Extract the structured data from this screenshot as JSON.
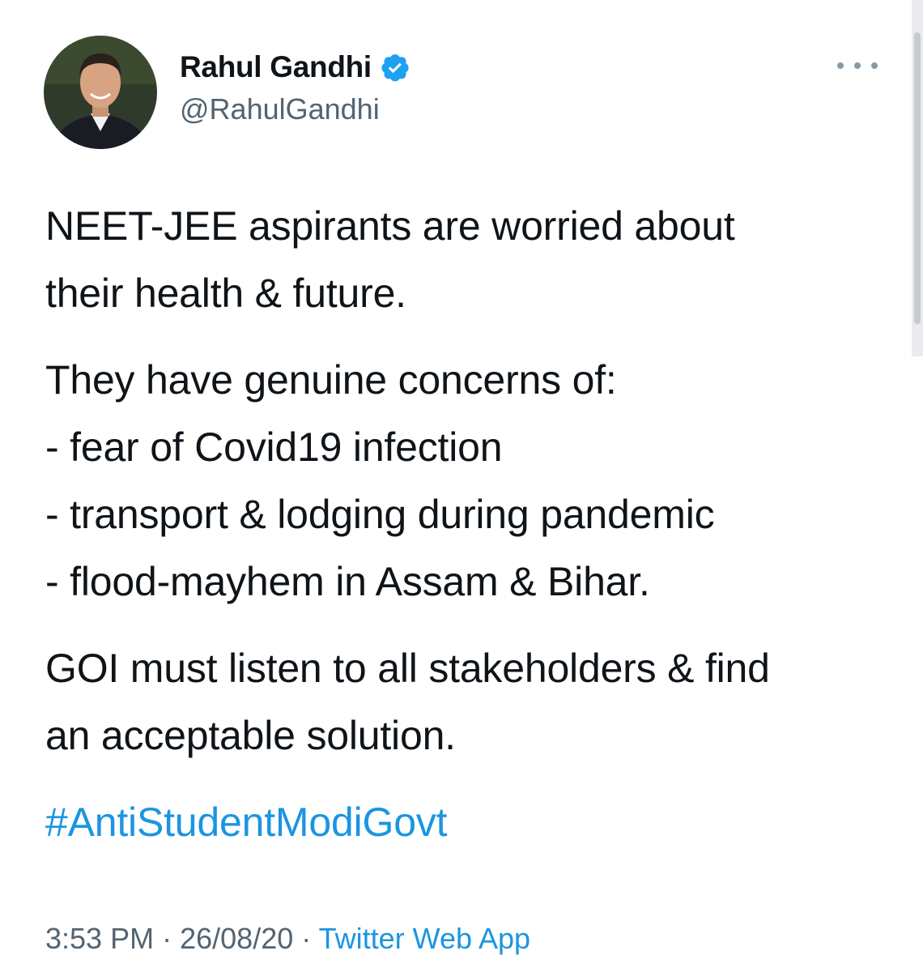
{
  "author": {
    "display_name": "Rahul Gandhi",
    "handle": "@RahulGandhi",
    "verified": true
  },
  "tweet": {
    "para1": [
      "NEET-JEE aspirants are worried about",
      "their health & future."
    ],
    "para2": [
      "They have genuine concerns of:",
      "- fear of Covid19 infection",
      "- transport & lodging during pandemic",
      "- flood-mayhem in Assam & Bihar."
    ],
    "para3": [
      "GOI must listen to all stakeholders & find",
      "an acceptable solution."
    ],
    "hashtag": "#AntiStudentModiGovt"
  },
  "meta": {
    "time": "3:53 PM",
    "separator": "·",
    "date": "26/08/20",
    "source": "Twitter Web App"
  },
  "colors": {
    "link": "#1b95e0",
    "secondary_text": "#536471",
    "verified_badge": "#1da1f2"
  },
  "icons": {
    "verified": "verified-badge-icon",
    "more": "more-options-icon"
  }
}
